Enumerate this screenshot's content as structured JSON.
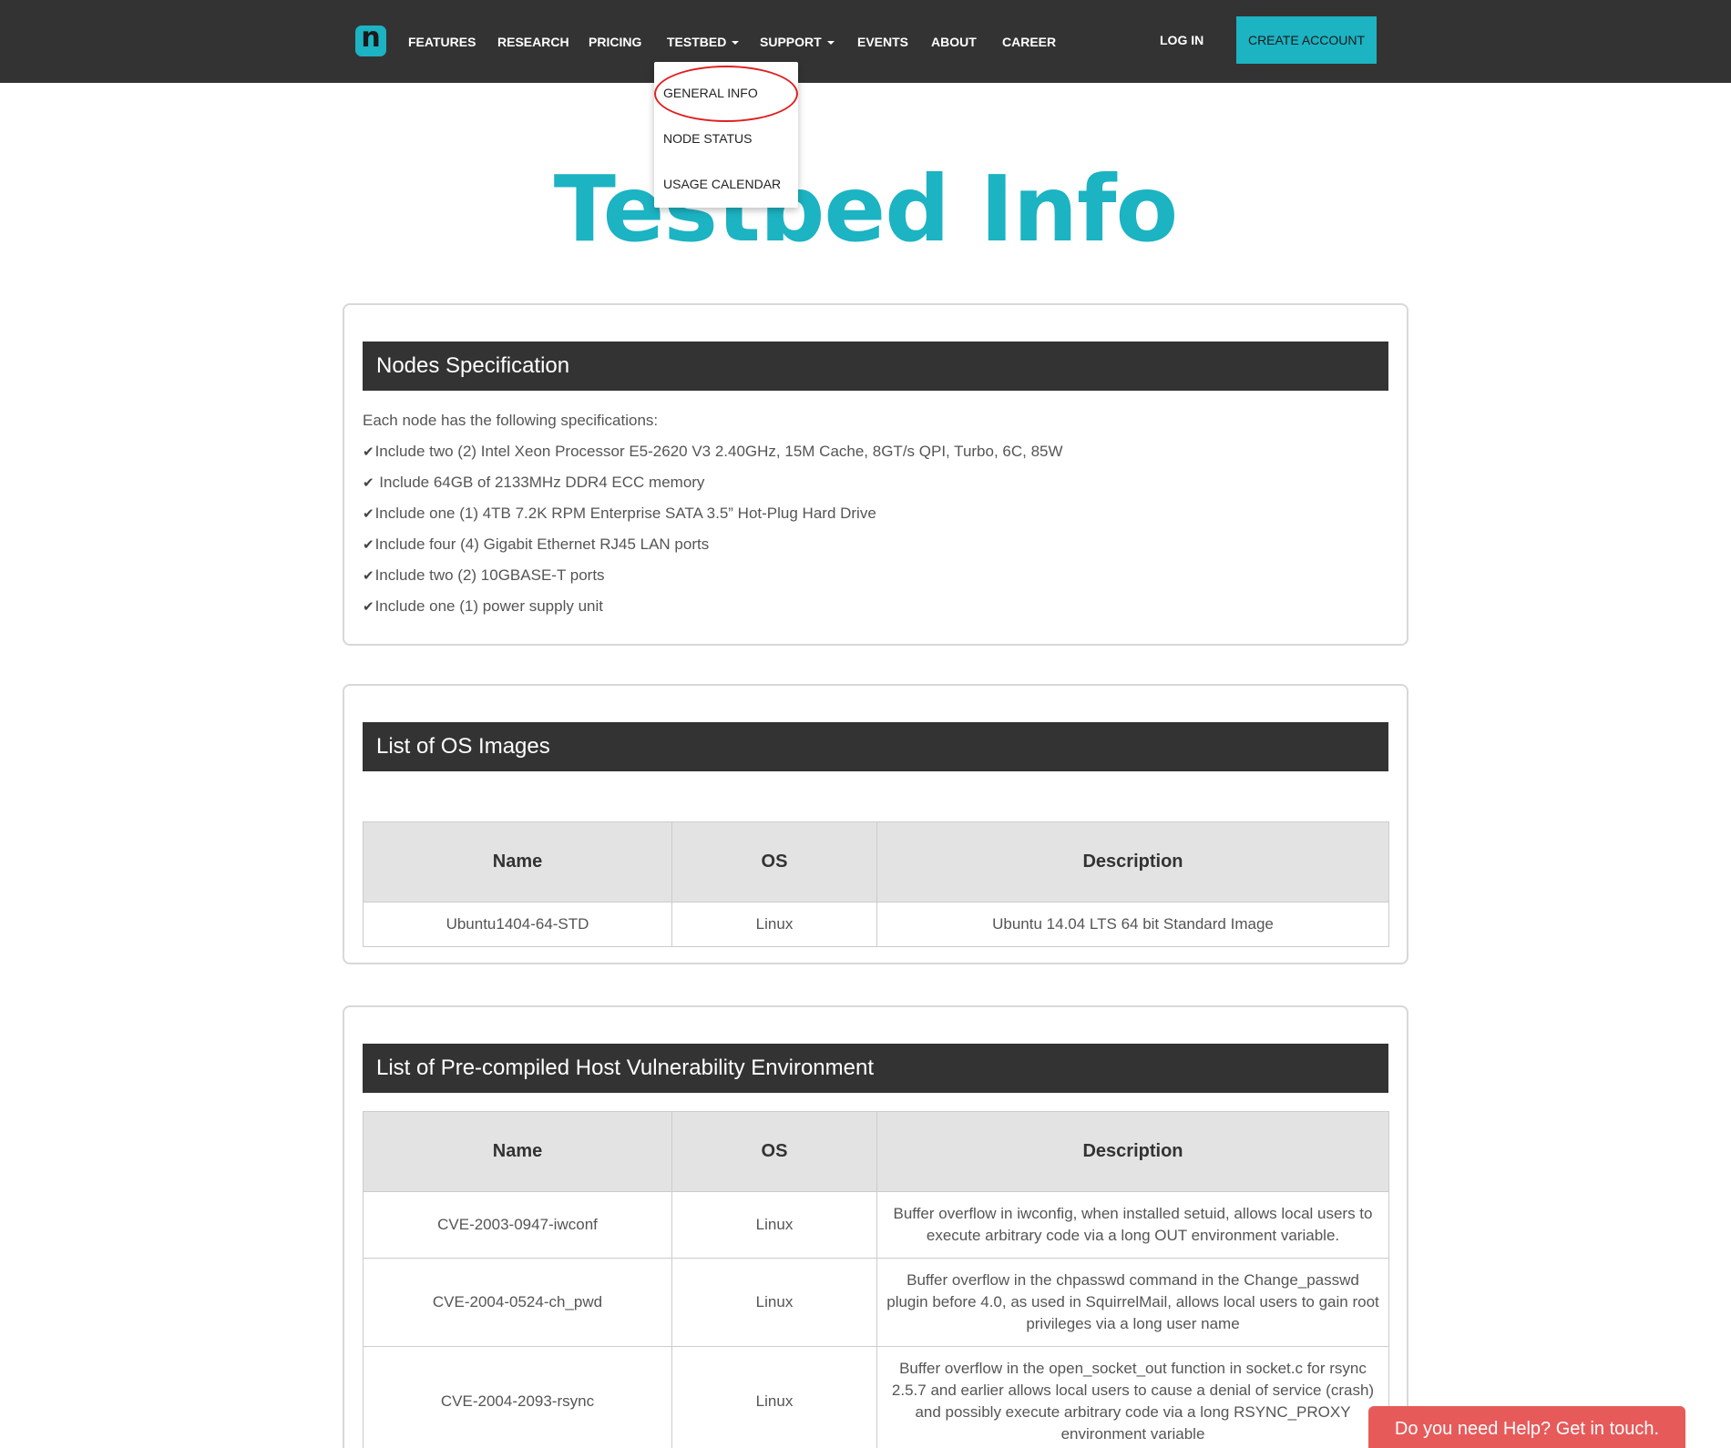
{
  "nav": {
    "logo_letter": "n",
    "items": [
      "FEATURES",
      "RESEARCH",
      "PRICING",
      "TESTBED",
      "SUPPORT",
      "EVENTS",
      "ABOUT",
      "CAREER"
    ],
    "login": "LOG IN",
    "create_account": "CREATE ACCOUNT"
  },
  "dropdown": {
    "items": [
      "GENERAL INFO",
      "NODE STATUS",
      "USAGE CALENDAR"
    ]
  },
  "hero": {
    "title": "Testbed Info"
  },
  "nodes": {
    "title": "Nodes Specification",
    "intro": "Each node has the following specifications:",
    "specs": [
      "Include two (2) Intel Xeon Processor E5-2620 V3 2.40GHz, 15M Cache, 8GT/s QPI, Turbo, 6C, 85W",
      " Include 64GB of 2133MHz DDR4 ECC memory",
      "Include one (1) 4TB 7.2K RPM Enterprise SATA 3.5” Hot-Plug Hard Drive",
      "Include four (4) Gigabit Ethernet RJ45 LAN ports",
      "Include two (2) 10GBASE-T ports",
      "Include one (1) power supply unit"
    ]
  },
  "os_images": {
    "title": "List of OS Images",
    "columns": [
      "Name",
      "OS",
      "Description"
    ],
    "rows": [
      [
        "Ubuntu1404-64-STD",
        "Linux",
        "Ubuntu 14.04 LTS 64 bit Standard Image"
      ]
    ]
  },
  "vuln_env": {
    "title": "List of Pre-compiled Host Vulnerability Environment",
    "columns": [
      "Name",
      "OS",
      "Description"
    ],
    "rows": [
      [
        "CVE-2003-0947-iwconf",
        "Linux",
        "Buffer overflow in iwconfig, when installed setuid, allows local users to execute arbitrary code via a long OUT environment variable."
      ],
      [
        "CVE-2004-0524-ch_pwd",
        "Linux",
        "Buffer overflow in the chpasswd command in the Change_passwd plugin before 4.0, as used in SquirrelMail, allows local users to gain root privileges via a long user name"
      ],
      [
        "CVE-2004-2093-rsync",
        "Linux",
        "Buffer overflow in the open_socket_out function in socket.c for rsync 2.5.7 and earlier allows local users to cause a denial of service (crash) and possibly execute arbitrary code via a long RSYNC_PROXY environment variable"
      ]
    ]
  },
  "help": {
    "label": "Do you need Help? Get in touch."
  },
  "colors": {
    "brand": "#1cb3c2",
    "navbar": "#333333",
    "help": "#e75a5a",
    "highlight": "#e02020"
  },
  "icons": {
    "check": "check-icon",
    "caret": "caret-down-icon"
  }
}
